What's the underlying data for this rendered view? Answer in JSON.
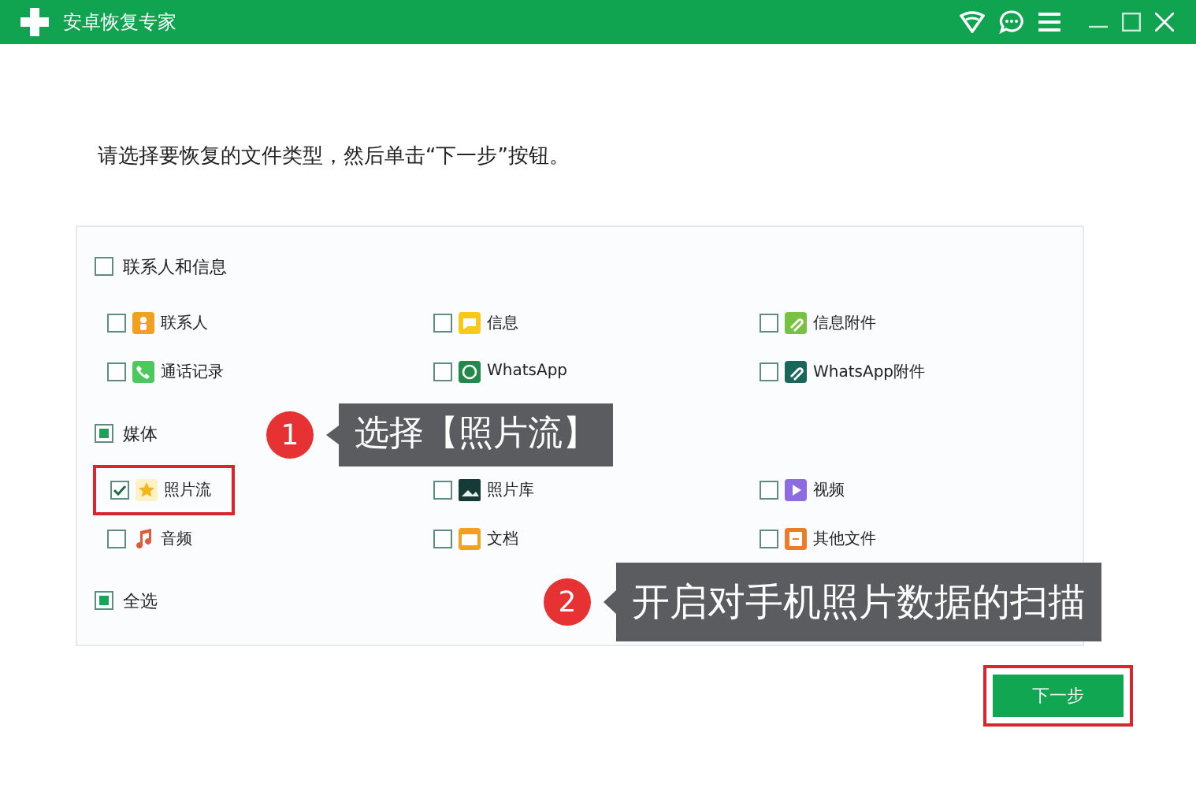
{
  "window": {
    "title": "安卓恢复专家"
  },
  "instruction": "请选择要恢复的文件类型，然后单击“下一步”按钮。",
  "groups": [
    {
      "label": "联系人和信息",
      "checked": false,
      "partial": false,
      "items": [
        {
          "label": "联系人",
          "checked": false,
          "highlighted": false
        },
        {
          "label": "信息",
          "checked": false,
          "highlighted": false
        },
        {
          "label": "信息附件",
          "checked": false,
          "highlighted": false
        },
        {
          "label": "通话记录",
          "checked": false,
          "highlighted": false
        },
        {
          "label": "WhatsApp",
          "checked": false,
          "highlighted": false
        },
        {
          "label": "WhatsApp附件",
          "checked": false,
          "highlighted": false
        }
      ]
    },
    {
      "label": "媒体",
      "checked": false,
      "partial": true,
      "items": [
        {
          "label": "照片流",
          "checked": true,
          "highlighted": true
        },
        {
          "label": "照片库",
          "checked": false,
          "highlighted": false
        },
        {
          "label": "视频",
          "checked": false,
          "highlighted": false
        },
        {
          "label": "音频",
          "checked": false,
          "highlighted": false
        },
        {
          "label": "文档",
          "checked": false,
          "highlighted": false
        },
        {
          "label": "其他文件",
          "checked": false,
          "highlighted": false
        }
      ]
    }
  ],
  "select_all": {
    "label": "全选",
    "checked": false,
    "partial": true
  },
  "next_button": {
    "label": "下一步",
    "highlighted": true
  },
  "callouts": [
    {
      "number": "1",
      "text": "选择【照片流】"
    },
    {
      "number": "2",
      "text": "开启对手机照片数据的扫描"
    }
  ]
}
